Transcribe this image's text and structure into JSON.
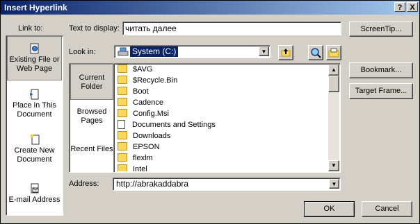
{
  "dialog": {
    "title": "Insert Hyperlink",
    "help_label": "?",
    "close_label": "X"
  },
  "link_to": {
    "label": "Link to:",
    "items": [
      {
        "label": "Existing File or Web Page",
        "icon": "globe-page-icon",
        "selected": true
      },
      {
        "label": "Place in This Document",
        "icon": "document-place-icon",
        "selected": false
      },
      {
        "label": "Create New Document",
        "icon": "new-document-icon",
        "selected": false
      },
      {
        "label": "E-mail Address",
        "icon": "email-icon",
        "selected": false
      }
    ]
  },
  "text_to_display": {
    "label": "Text to display:",
    "value": "читать далее"
  },
  "screentip_button": "ScreenTip...",
  "look_in": {
    "label": "Look in:",
    "value": "System (C:)"
  },
  "left_tabs": [
    {
      "label": "Current Folder",
      "selected": true
    },
    {
      "label": "Browsed Pages",
      "selected": false
    },
    {
      "label": "Recent Files",
      "selected": false
    }
  ],
  "files": [
    {
      "name": "$AVG",
      "type": "folder"
    },
    {
      "name": "$Recycle.Bin",
      "type": "folder"
    },
    {
      "name": "Boot",
      "type": "folder"
    },
    {
      "name": "Cadence",
      "type": "folder"
    },
    {
      "name": "Config.Msi",
      "type": "folder"
    },
    {
      "name": "Documents and Settings",
      "type": "shortcut"
    },
    {
      "name": "Downloads",
      "type": "folder"
    },
    {
      "name": "EPSON",
      "type": "folder"
    },
    {
      "name": "flexlm",
      "type": "folder"
    },
    {
      "name": "Intel",
      "type": "folder"
    }
  ],
  "right_buttons": {
    "bookmark": "Bookmark...",
    "target_frame": "Target Frame..."
  },
  "address": {
    "label": "Address:",
    "value": "http://abrakaddabra"
  },
  "ok_label": "OK",
  "cancel_label": "Cancel",
  "colors": {
    "title_start": "#0a246a",
    "title_end": "#a6caf0",
    "selection": "#0a246a",
    "face": "#d4d0c8"
  }
}
